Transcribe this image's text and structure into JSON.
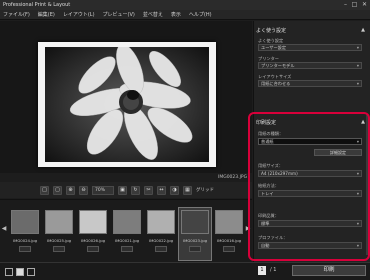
{
  "window": {
    "title": "Professional Print & Layout",
    "controls": [
      "–",
      "□",
      "✕"
    ]
  },
  "menu": [
    "ファイル(F)",
    "編集(E)",
    "レイアウト(L)",
    "プレビュー(V)",
    "並べ替え",
    "表示",
    "ヘルプ(H)"
  ],
  "preview": {
    "filename": "IMG0023.JPG",
    "image": "black-and-white flower with insect"
  },
  "toolbar": {
    "zoom_value": "70%",
    "grid_label": "グリッド"
  },
  "filmstrip": {
    "thumbs": [
      {
        "caption": "IMG0024.jpg"
      },
      {
        "caption": "IMG0025.jpg"
      },
      {
        "caption": "IMG0026.jpg"
      },
      {
        "caption": "IMG0021.jpg"
      },
      {
        "caption": "IMG0022.jpg"
      },
      {
        "caption": "IMG0023.jpg"
      },
      {
        "caption": "IMG0016.jpg"
      }
    ]
  },
  "panel": {
    "top_section": {
      "title": "よく使う設定",
      "fields": [
        {
          "label": "よく使う設定",
          "value": "ユーザー設定"
        },
        {
          "label": "プリンター",
          "value": "プリンターモデル"
        },
        {
          "label": "レイアウトサイズ",
          "value": "用紙に合わせる"
        }
      ]
    },
    "print_section": {
      "title": "印刷設定",
      "paper_type_label": "用紙の種類：",
      "paper_type_value": "普通紙",
      "paper_detail_button": "詳細設定",
      "paper_size_label": "用紙サイズ：",
      "paper_size_value": "A4 (210x297mm)",
      "source_label": "給紙方法：",
      "source_value": "トレイ",
      "quality_label": "印刷品質：",
      "quality_value": "標準",
      "profile_label": "プロファイル：",
      "profile_value": "自動"
    }
  },
  "footer": {
    "page_current": "1",
    "page_total": "/ 1",
    "print_button": "印刷"
  }
}
